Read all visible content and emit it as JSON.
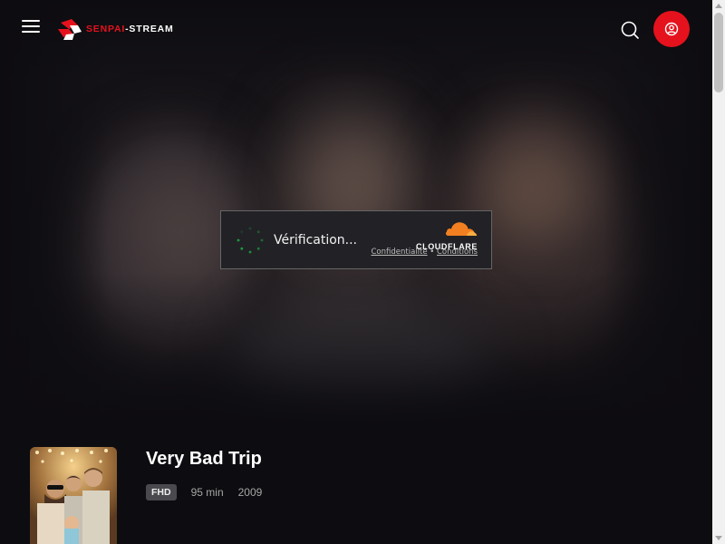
{
  "header": {
    "logo_primary": "SENPAI",
    "logo_secondary": "-STREAM",
    "menu_icon": "hamburger-menu-icon",
    "search_icon": "search-icon",
    "user_icon": "user-circle-icon",
    "accent_color": "#e5121d"
  },
  "captcha": {
    "status": "Vérification...",
    "brand": "CLOUDFLARE",
    "privacy_link": "Confidentialité",
    "separator": "•",
    "terms_link": "Conditions",
    "spinner_color": "#1a9d3c",
    "brand_color": "#f38020"
  },
  "movie": {
    "title": "Very Bad Trip",
    "quality": "FHD",
    "duration": "95 min",
    "year": "2009"
  }
}
